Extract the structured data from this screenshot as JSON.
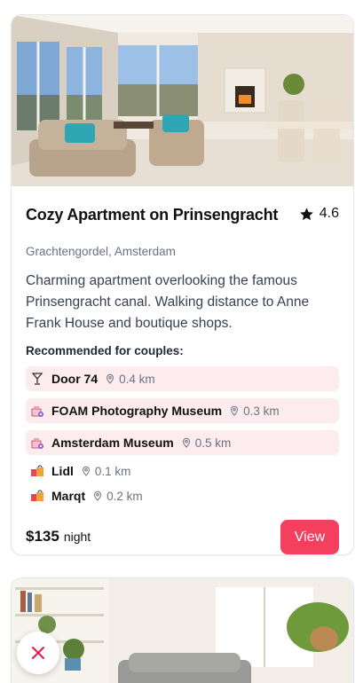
{
  "listing": {
    "title": "Cozy Apartment on Prinsengracht",
    "rating": "4.6",
    "location": "Grachtengordel, Amsterdam",
    "description": "Charming apartment overlooking the famous Prinsengracht canal. Walking distance to Anne Frank House and boutique shops.",
    "recommended_title": "Recommended for couples:",
    "recommendations": [
      {
        "name": "Door 74",
        "distance": "0.4 km",
        "icon": "cocktail-icon",
        "highlighted": true
      },
      {
        "name": "FOAM Photography Museum",
        "distance": "0.3 km",
        "icon": "museum-icon",
        "highlighted": true
      },
      {
        "name": "Amsterdam Museum",
        "distance": "0.5 km",
        "icon": "museum-icon",
        "highlighted": true
      },
      {
        "name": "Lidl",
        "distance": "0.1 km",
        "icon": "shopping-icon",
        "highlighted": false
      },
      {
        "name": "Marqt",
        "distance": "0.2 km",
        "icon": "shopping-icon",
        "highlighted": false
      }
    ],
    "price": "$135",
    "price_unit": "night",
    "view_label": "View"
  },
  "colors": {
    "accent": "#f43f5e",
    "highlight_bg": "#fdecee",
    "muted_text": "#6b7280",
    "close_icon": "#e11d48"
  }
}
